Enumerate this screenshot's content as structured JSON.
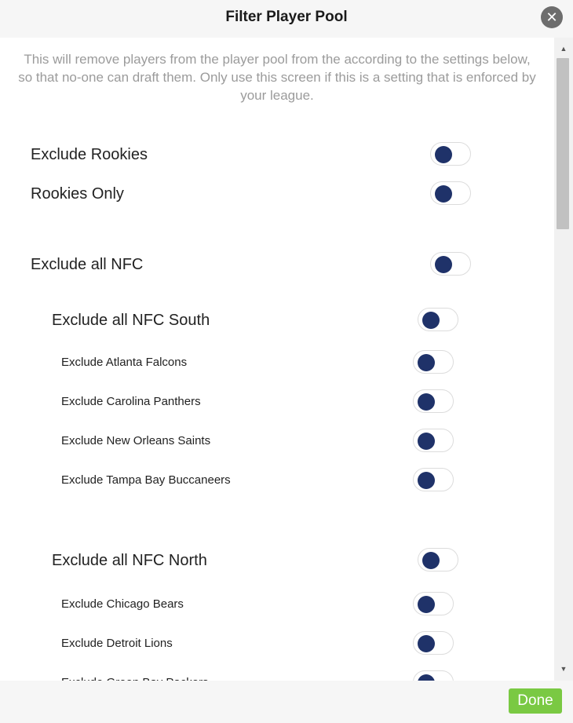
{
  "dialog": {
    "title": "Filter Player Pool",
    "close_icon": "close-icon",
    "description": "This will remove players from the player pool from the according to the settings below, so that no-one can draft them. Only use this screen if this is a setting that is enforced by your league.",
    "done_label": "Done"
  },
  "colors": {
    "toggle_knob": "#1f3269",
    "done_button": "#7ac943",
    "description_text": "#9b9b9b"
  },
  "filters": {
    "exclude_rookies": {
      "label": "Exclude Rookies",
      "enabled": false
    },
    "rookies_only": {
      "label": "Rookies Only",
      "enabled": false
    },
    "exclude_nfc": {
      "label": "Exclude all NFC",
      "enabled": false
    },
    "nfc_south": {
      "label": "Exclude all NFC South",
      "enabled": false,
      "teams": [
        {
          "label": "Exclude Atlanta Falcons",
          "enabled": false
        },
        {
          "label": "Exclude Carolina Panthers",
          "enabled": false
        },
        {
          "label": "Exclude New Orleans Saints",
          "enabled": false
        },
        {
          "label": "Exclude Tampa Bay Buccaneers",
          "enabled": false
        }
      ]
    },
    "nfc_north": {
      "label": "Exclude all NFC North",
      "enabled": false,
      "teams": [
        {
          "label": "Exclude Chicago Bears",
          "enabled": false
        },
        {
          "label": "Exclude Detroit Lions",
          "enabled": false
        },
        {
          "label": "Exclude Green Bay Packers",
          "enabled": false
        }
      ]
    }
  }
}
